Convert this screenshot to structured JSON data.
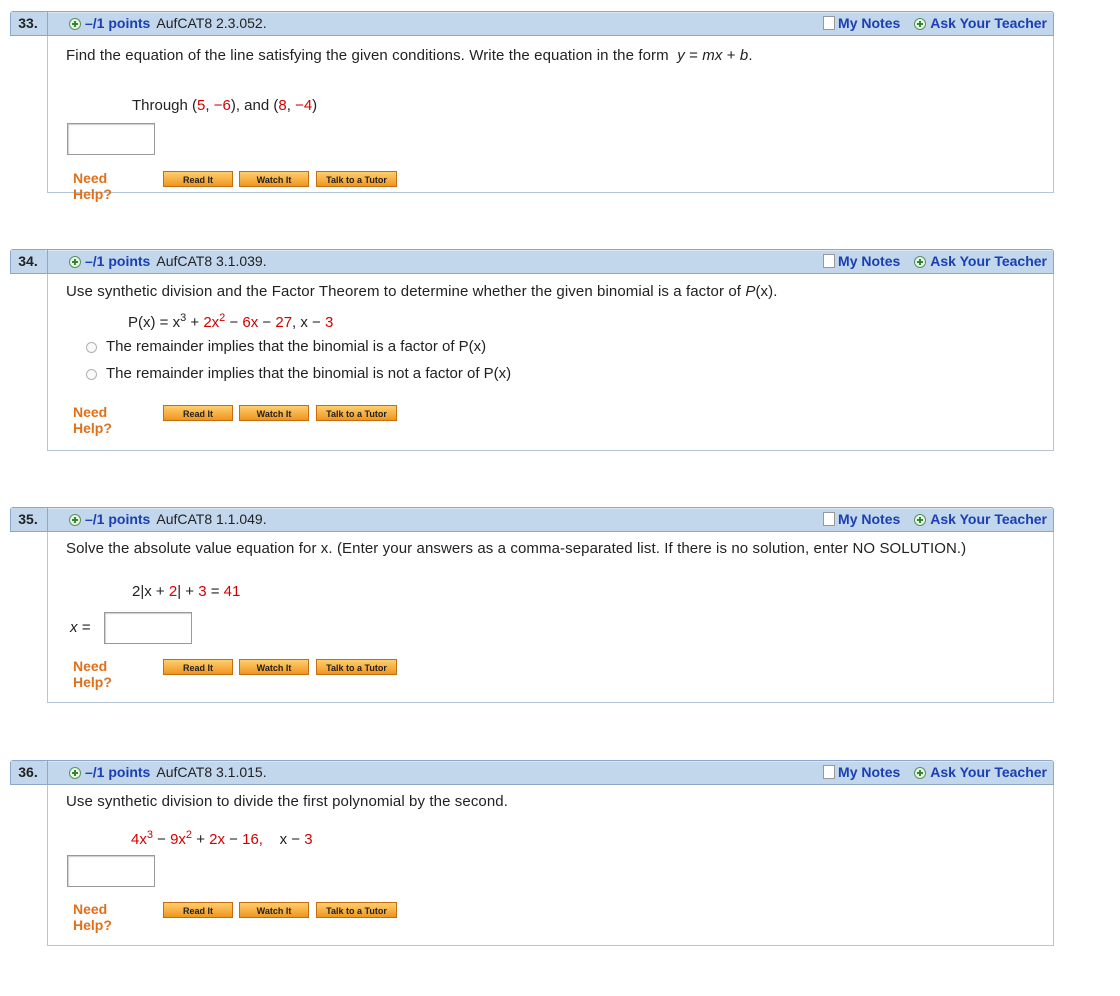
{
  "questions": [
    {
      "number": "33.",
      "points": "–/1 points",
      "code": "AufCAT8 2.3.052.",
      "prompt": "Find the equation of the line satisfying the given conditions. Write the equation in the form",
      "form": {
        "y": "y",
        "eq": " = ",
        "mx": "mx",
        "plus": " + ",
        "b": "b",
        "end": "."
      },
      "through": {
        "label": "Through (",
        "p1x": "5",
        "sep1": ", ",
        "p1y": "−6",
        "mid": "), and (",
        "p2x": "8",
        "sep2": ", ",
        "p2y": "−4",
        "end": ")"
      }
    },
    {
      "number": "34.",
      "points": "–/1 points",
      "code": "AufCAT8 3.1.039.",
      "prompt": "Use synthetic division and the Factor Theorem to determine whether the given binomial is a factor of",
      "prompt_func": "P",
      "prompt_func_arg": "(x).",
      "equation": {
        "lhs": "P(x) = x",
        "e1": "3",
        "t2op": " + ",
        "t2": "2x",
        "e2": "2",
        "t3op": " − ",
        "t3": "6x",
        "t4op": " − ",
        "t4": "27",
        "comma": ",  x − ",
        "bin": "3"
      },
      "options": [
        "The remainder implies that the binomial is a factor of P(x)",
        "The remainder implies that the binomial is not a factor of P(x)"
      ]
    },
    {
      "number": "35.",
      "points": "–/1 points",
      "code": "AufCAT8 1.1.049.",
      "prompt": "Solve the absolute value equation for x. (Enter your answers as a comma-separated list. If there is no solution, enter NO SOLUTION.)",
      "equation": {
        "a": "2|x + ",
        "b": "2",
        "c": "| + ",
        "d": "3",
        "e": " = ",
        "f": "41"
      },
      "answer_label": "x ="
    },
    {
      "number": "36.",
      "points": "–/1 points",
      "code": "AufCAT8 3.1.015.",
      "prompt": "Use synthetic division to divide the first polynomial by the second.",
      "equation": {
        "c1": "4x",
        "e1": "3",
        "op1": " − ",
        "c2": "9x",
        "e2": "2",
        "op2": " + ",
        "c3": "2x",
        "op3": " − ",
        "c4": "16,",
        "sp": "    x − ",
        "c5": "3"
      }
    }
  ],
  "header": {
    "my_notes": "My Notes",
    "ask_teacher": "Ask Your Teacher"
  },
  "help": {
    "label": "Need Help?",
    "read": "Read It",
    "watch": "Watch It",
    "tutor": "Talk to a Tutor"
  },
  "colors": {
    "header_bg": "#c2d6ec",
    "link": "#1a3fb0",
    "help_label": "#e0701a",
    "math_red": "#d40000"
  }
}
